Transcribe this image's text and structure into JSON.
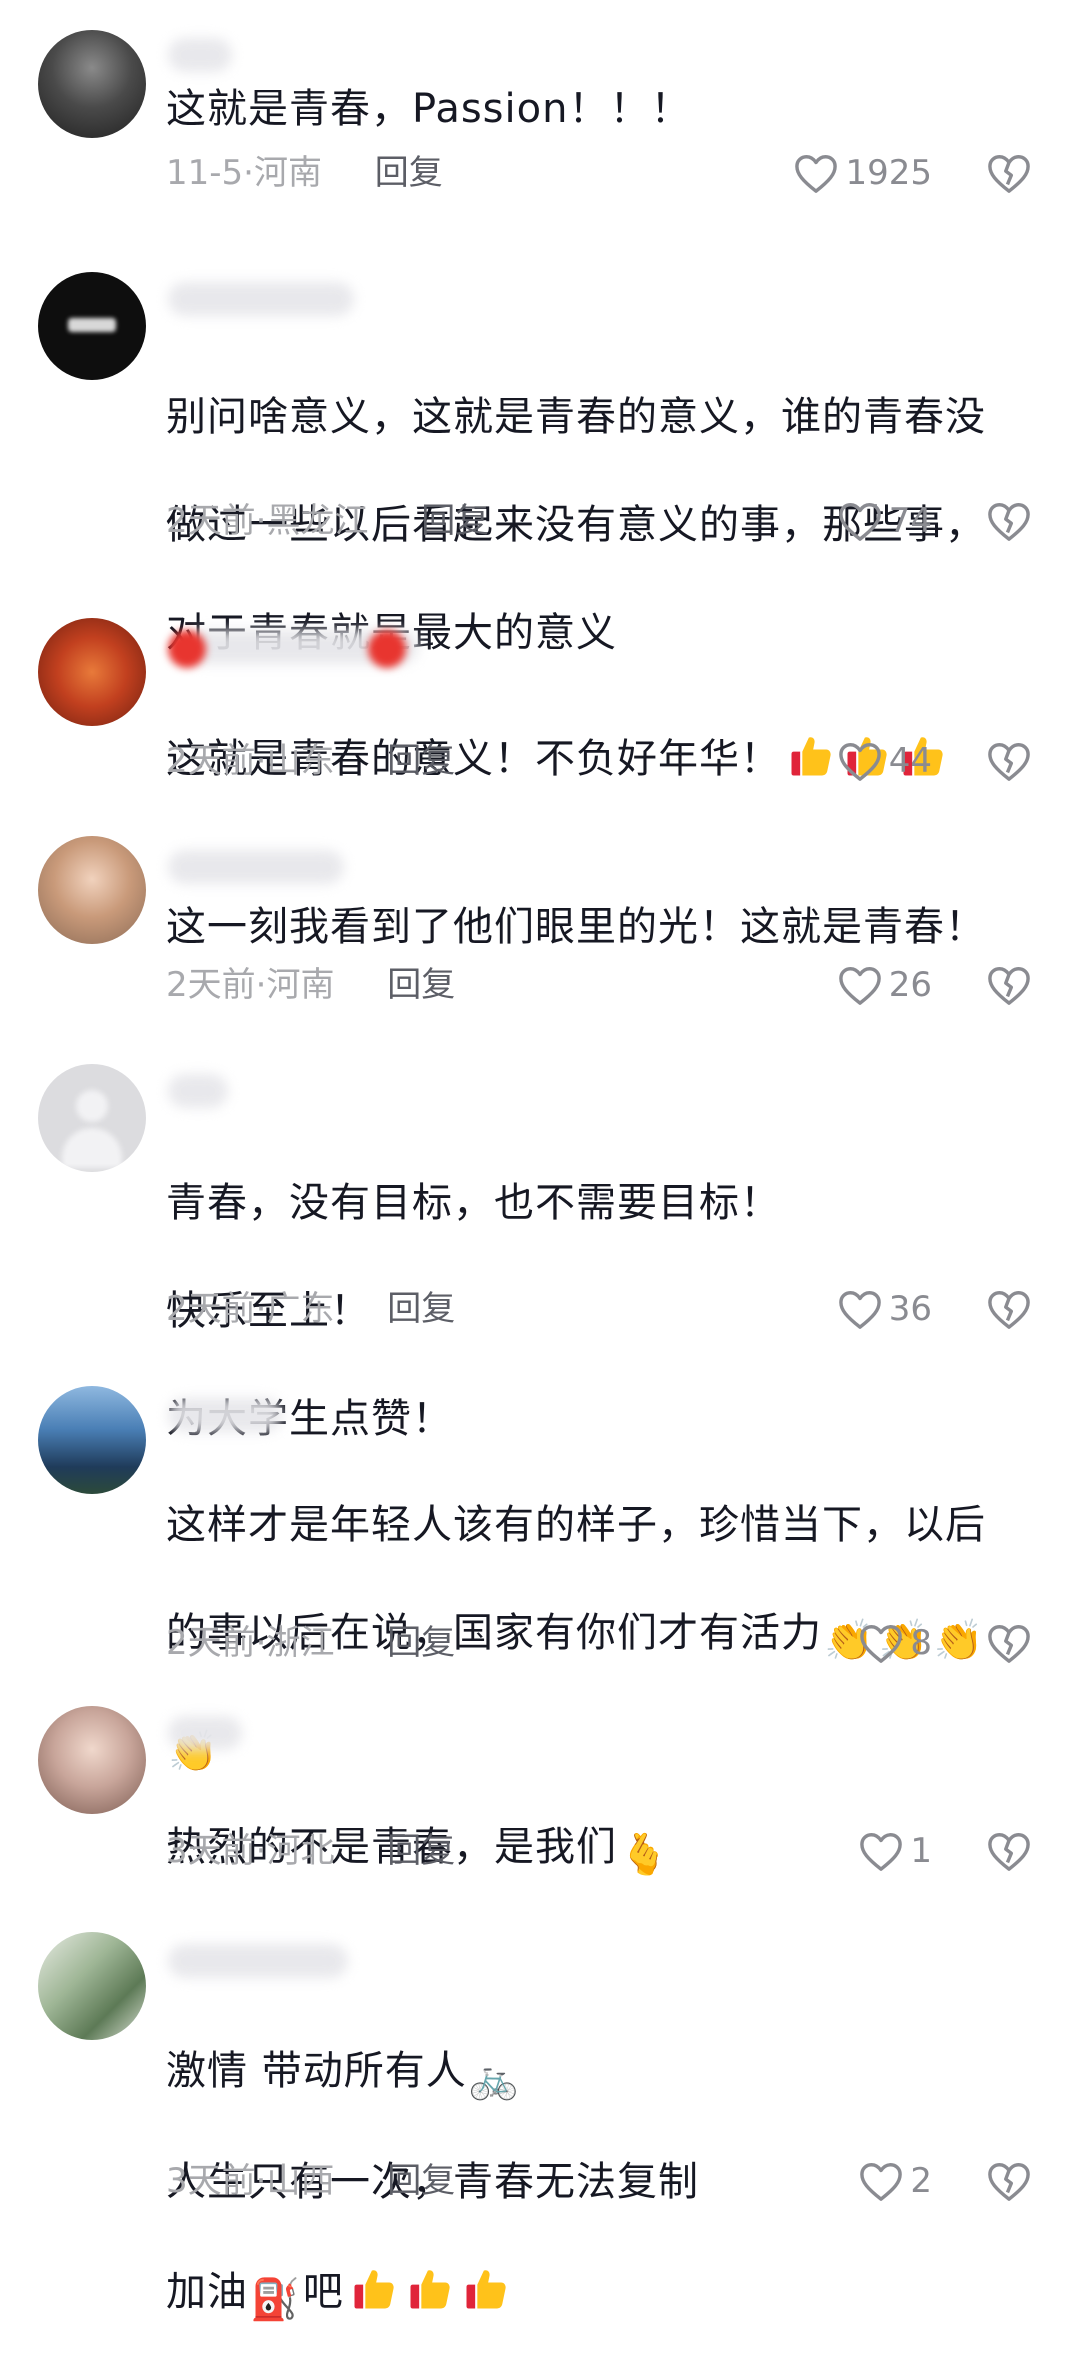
{
  "comments": [
    {
      "text": "这就是青春，Passion！！！",
      "date": "11-5",
      "location": "河南",
      "reply": "回复",
      "likes": "1925",
      "avatar_color": "#3b3b3b"
    },
    {
      "text_lines": [
        "别问啥意义，这就是青春的意义，谁的青春没",
        "做过一些以后看起来没有意义的事，那些事，",
        "对于青春就是最大的意义"
      ],
      "date": "2天前",
      "location": "黑龙江",
      "reply": "回复",
      "likes": "74",
      "avatar_color": "#0e0e0e"
    },
    {
      "text": "这就是青春的意义！不负好年华！",
      "date": "2天前",
      "location": "山东",
      "reply": "回复",
      "likes": "44",
      "avatar_color": "#b13a1d"
    },
    {
      "text": "这一刻我看到了他们眼里的光！这就是青春！",
      "date": "2天前",
      "location": "河南",
      "reply": "回复",
      "likes": "26",
      "avatar_color": "#c99a7a"
    },
    {
      "text_lines": [
        "青春，没有目标，也不需要目标！",
        "快乐至上！",
        "为大学生点赞！"
      ],
      "date": "2天前",
      "location": "广东",
      "reply": "回复",
      "likes": "36",
      "avatar_color": "#d4d4d8"
    },
    {
      "text_lines": [
        "这样才是年轻人该有的样子，珍惜当下，以后",
        "的事以后在说，国家有你们才有活力"
      ],
      "date": "2天前",
      "location": "浙江",
      "reply": "回复",
      "likes": "8",
      "avatar_color": "#4a7fb5"
    },
    {
      "text": "热烈的不是青春，是我们",
      "date": "3天前",
      "location": "河北",
      "reply": "回复",
      "likes": "1",
      "avatar_color": "#c8a59a"
    },
    {
      "text_lines": [
        "激情 带动所有人",
        "人生只有一次，青春无法复制",
        "加油",
        "吧"
      ],
      "date": "3天前",
      "location": "山西",
      "reply": "回复",
      "likes": "2",
      "avatar_color": "#7f9a77"
    }
  ],
  "separator": "·",
  "icons": {
    "like": "heart-outline-icon",
    "dislike": "broken-heart-icon",
    "thumbs_up": "thumbs-up-emoji",
    "clap": "clapping-hands-emoji",
    "finger_heart": "finger-heart-emoji",
    "bicycle": "bicycle-emoji",
    "fuel": "fuel-pump-emoji"
  },
  "colors": {
    "text": "#161823",
    "meta": "#a8a9ad",
    "reply": "#5c5e66",
    "icon": "#8a8b91"
  }
}
